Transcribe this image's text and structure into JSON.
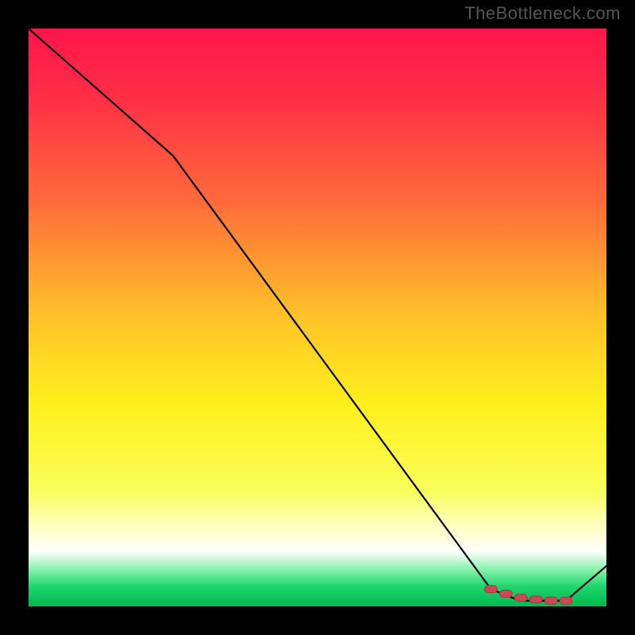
{
  "watermark": "TheBottleneck.com",
  "colors": {
    "frame": "#000000",
    "watermark": "#555555",
    "line": "#000000",
    "marker_fill": "#c94a55",
    "marker_stroke": "#a43844",
    "gradient_stops": [
      {
        "offset": 0.0,
        "color": "#ff154c"
      },
      {
        "offset": 0.12,
        "color": "#ff2f46"
      },
      {
        "offset": 0.3,
        "color": "#ff6b3a"
      },
      {
        "offset": 0.5,
        "color": "#ffc328"
      },
      {
        "offset": 0.65,
        "color": "#fff01c"
      },
      {
        "offset": 0.8,
        "color": "#f7ff5a"
      },
      {
        "offset": 0.86,
        "color": "#ffffc0"
      },
      {
        "offset": 0.905,
        "color": "#ffffff"
      },
      {
        "offset": 0.935,
        "color": "#8cf2b0"
      },
      {
        "offset": 0.965,
        "color": "#20d66e"
      },
      {
        "offset": 1.0,
        "color": "#00b84e"
      }
    ]
  },
  "chart_data": {
    "type": "line",
    "title": "",
    "xlabel": "",
    "ylabel": "",
    "xlim": [
      0,
      100
    ],
    "ylim": [
      0,
      100
    ],
    "grid": false,
    "series": [
      {
        "name": "curve",
        "x": [
          0,
          25,
          80,
          85,
          93,
          100
        ],
        "values": [
          100,
          78,
          3,
          1,
          1,
          7
        ]
      }
    ],
    "markers": {
      "name": "flat-segment-markers",
      "x": [
        80,
        82.6,
        85.2,
        87.8,
        90.4,
        93
      ],
      "values": [
        3,
        2.2,
        1.5,
        1.2,
        1,
        1
      ]
    }
  }
}
